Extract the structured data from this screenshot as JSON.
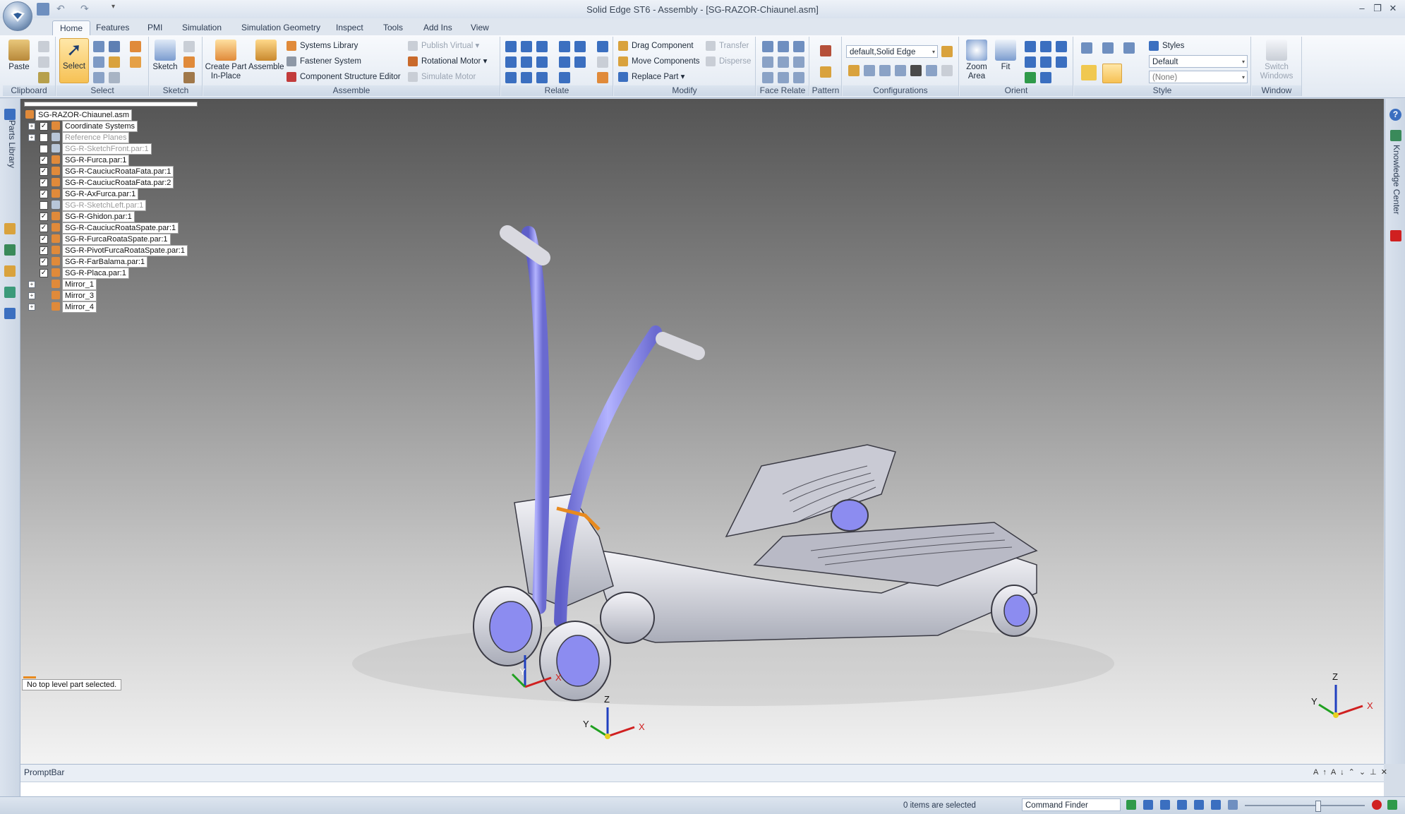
{
  "window": {
    "title": "Solid Edge ST6 - Assembly - [SG-RAZOR-Chiaunel.asm]"
  },
  "menu_tabs": [
    "Home",
    "Features",
    "PMI",
    "Simulation",
    "Simulation Geometry",
    "Inspect",
    "Tools",
    "Add Ins",
    "View"
  ],
  "ribbon": {
    "clipboard": {
      "label": "Clipboard",
      "paste": "Paste"
    },
    "select": {
      "label": "Select",
      "select_btn": "Select"
    },
    "sketch": {
      "label": "Sketch",
      "sketch_btn": "Sketch"
    },
    "assemble": {
      "label": "Assemble",
      "create_part": "Create Part In-Place",
      "assemble_btn": "Assemble",
      "systems_library": "Systems Library",
      "fastener_system": "Fastener System",
      "component_structure_editor": "Component Structure Editor",
      "publish_virtual": "Publish Virtual",
      "rotational_motor": "Rotational Motor",
      "simulate_motor": "Simulate Motor"
    },
    "relate": {
      "label": "Relate"
    },
    "modify": {
      "label": "Modify",
      "drag_component": "Drag Component",
      "move_components": "Move Components",
      "replace_part": "Replace Part",
      "transfer": "Transfer",
      "disperse": "Disperse"
    },
    "face_relate": {
      "label": "Face Relate"
    },
    "pattern": {
      "label": "Pattern"
    },
    "configurations": {
      "label": "Configurations",
      "combo_value": "default,Solid Edge"
    },
    "orient": {
      "label": "Orient",
      "zoom_area": "Zoom Area",
      "fit": "Fit"
    },
    "style": {
      "label": "Style",
      "styles": "Styles",
      "style_value": "Default",
      "none_value": "(None)"
    },
    "window": {
      "label": "Window",
      "switch_windows": "Switch Windows"
    }
  },
  "side_tabs": {
    "left": "Parts Library",
    "right": "Knowledge Center"
  },
  "tree": {
    "root": "SG-RAZOR-Chiaunel.asm",
    "items": [
      {
        "label": "Coordinate Systems",
        "expand": true,
        "checked": true,
        "dim": false
      },
      {
        "label": "Reference Planes",
        "expand": true,
        "checked": false,
        "dim": true
      },
      {
        "label": "SG-R-SketchFront.par:1",
        "expand": false,
        "checked": false,
        "dim": true
      },
      {
        "label": "SG-R-Furca.par:1",
        "expand": false,
        "checked": true,
        "dim": false
      },
      {
        "label": "SG-R-CauciucRoataFata.par:1",
        "expand": false,
        "checked": true,
        "dim": false
      },
      {
        "label": "SG-R-CauciucRoataFata.par:2",
        "expand": false,
        "checked": true,
        "dim": false
      },
      {
        "label": "SG-R-AxFurca.par:1",
        "expand": false,
        "checked": true,
        "dim": false
      },
      {
        "label": "SG-R-SketchLeft.par:1",
        "expand": false,
        "checked": false,
        "dim": true
      },
      {
        "label": "SG-R-Ghidon.par:1",
        "expand": false,
        "checked": true,
        "dim": false
      },
      {
        "label": "SG-R-CauciucRoataSpate.par:1",
        "expand": false,
        "checked": true,
        "dim": false
      },
      {
        "label": "SG-R-FurcaRoataSpate.par:1",
        "expand": false,
        "checked": true,
        "dim": false
      },
      {
        "label": "SG-R-PivotFurcaRoataSpate.par:1",
        "expand": false,
        "checked": true,
        "dim": false
      },
      {
        "label": "SG-R-FarBalama.par:1",
        "expand": false,
        "checked": true,
        "dim": false
      },
      {
        "label": "SG-R-Placa.par:1",
        "expand": false,
        "checked": true,
        "dim": false
      },
      {
        "label": "Mirror_1",
        "expand": true,
        "checked": null,
        "dim": false
      },
      {
        "label": "Mirror_3",
        "expand": true,
        "checked": null,
        "dim": false
      },
      {
        "label": "Mirror_4",
        "expand": true,
        "checked": null,
        "dim": false
      }
    ]
  },
  "status_note": "No top level part selected.",
  "axes": {
    "x": "X",
    "y": "Y",
    "z": "Z"
  },
  "promptbar": {
    "title": "PromptBar"
  },
  "statusbar": {
    "items_selected": "0 items are selected",
    "command_finder": "Command Finder"
  },
  "colors": {
    "accent": "#1f3f6e",
    "tube": "#8c8cf0",
    "highlight": "#e88a1e"
  }
}
